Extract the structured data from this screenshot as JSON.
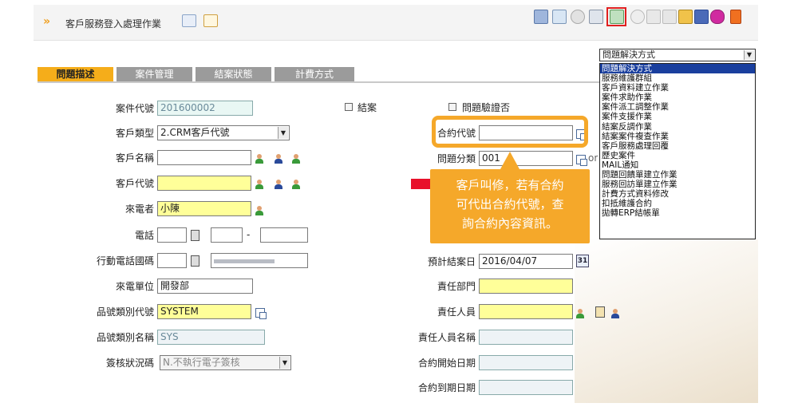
{
  "header": {
    "title": "客戶服務登入處理作業",
    "arrows": "»"
  },
  "tabs": [
    {
      "label": "問題描述",
      "active": true
    },
    {
      "label": "案件管理",
      "active": false
    },
    {
      "label": "結案狀態",
      "active": false
    },
    {
      "label": "計費方式",
      "active": false
    }
  ],
  "form": {
    "case_no": {
      "label": "案件代號",
      "value": "201600002"
    },
    "closed": {
      "label": "結案"
    },
    "verified": {
      "label": "問題驗證否"
    },
    "customer_type": {
      "label": "客戶類型",
      "value": "2.CRM客戶代號"
    },
    "contract_no": {
      "label": "合約代號",
      "value": ""
    },
    "customer_name": {
      "label": "客戶名稱",
      "value": ""
    },
    "problem_category": {
      "label": "問題分類",
      "value": "001",
      "suffix": "or"
    },
    "customer_code": {
      "label": "客戶代號",
      "value": ""
    },
    "caller": {
      "label": "來電者",
      "value": "小陳"
    },
    "phone": {
      "label": "電話",
      "dash": "-"
    },
    "mobile": {
      "label": "行動電話國碼"
    },
    "expected_close": {
      "label": "預計結案日",
      "value": "2016/04/07",
      "cal": "31"
    },
    "dept": {
      "label": "來電單位",
      "value": "開發部"
    },
    "resp_dept": {
      "label": "責任部門",
      "value": ""
    },
    "product_code": {
      "label": "品號類別代號",
      "value": "SYSTEM"
    },
    "resp_person": {
      "label": "責任人員",
      "value": ""
    },
    "product_name": {
      "label": "品號類別名稱",
      "value": "SYS"
    },
    "resp_person_name": {
      "label": "責任人員名稱",
      "value": ""
    },
    "approval": {
      "label": "簽核狀況碼",
      "value": "N.不執行電子簽核"
    },
    "contract_start": {
      "label": "合約開始日期",
      "value": ""
    },
    "contract_end": {
      "label": "合約到期日期",
      "value": ""
    }
  },
  "tooltip": {
    "lines": [
      "客戶叫修，若有合約",
      "可代出合約代號，查",
      "詢合約內容資訊。"
    ]
  },
  "dropdown": {
    "selected": "問題解決方式",
    "options": [
      "問題解決方式",
      "服務維護群組",
      "客戶資料建立作業",
      "案件求助作業",
      "案件派工調整作業",
      "案件支援作業",
      "結案反調作業",
      "結案案件複查作業",
      "客戶服務處理回覆",
      "歷史案件",
      "MAIL通知",
      "問題回饋單建立作業",
      "服務回訪單建立作業",
      "計費方式資料修改",
      "扣抵維護合約",
      "拋轉ERP結帳單"
    ]
  },
  "colors": {
    "accent": "#f5a82a",
    "tab_active": "#f5ad1a",
    "tab_inactive": "#9b9b9b",
    "required_field": "#ffff99",
    "highlight": "#e02020"
  }
}
